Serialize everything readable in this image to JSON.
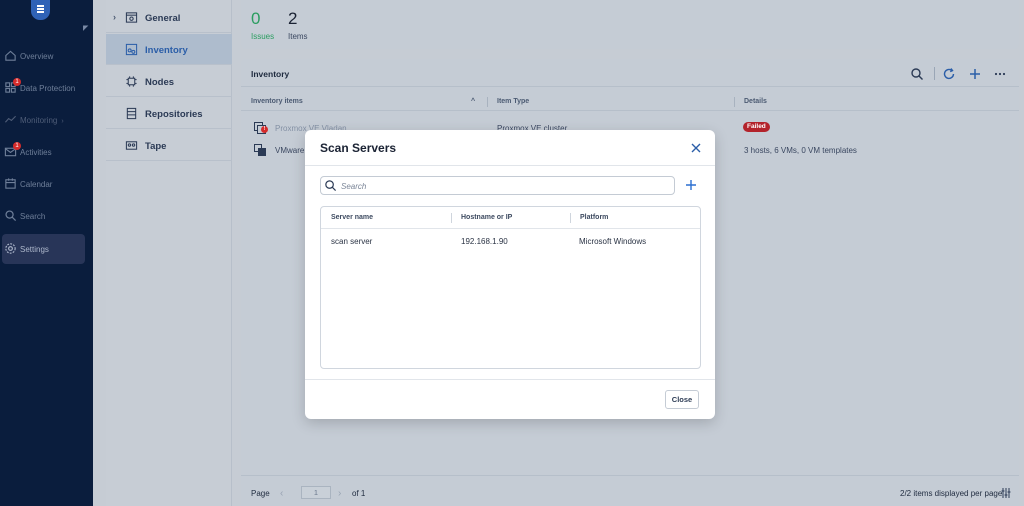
{
  "nav": {
    "items": [
      {
        "label": "Overview",
        "icon": "home-icon"
      },
      {
        "label": "Data Protection",
        "icon": "grid-icon",
        "badge": "1"
      },
      {
        "label": "Monitoring",
        "icon": "chart-icon",
        "suffix": "›"
      },
      {
        "label": "Activities",
        "icon": "mail-icon",
        "badge": "1"
      },
      {
        "label": "Calendar",
        "icon": "calendar-icon"
      },
      {
        "label": "Search",
        "icon": "search-icon"
      },
      {
        "label": "Settings",
        "icon": "gear-icon"
      }
    ]
  },
  "settings_menu": {
    "items": [
      {
        "label": "General"
      },
      {
        "label": "Inventory"
      },
      {
        "label": "Nodes"
      },
      {
        "label": "Repositories"
      },
      {
        "label": "Tape"
      }
    ]
  },
  "stats": {
    "issues_count": "0",
    "issues_label": "Issues",
    "items_count": "2",
    "items_label": "Items"
  },
  "inventory": {
    "title": "Inventory",
    "columns": [
      "Inventory items",
      "Item Type",
      "Details"
    ],
    "rows": [
      {
        "name": "Proxmox VE Vladan",
        "type": "Proxmox VE cluster",
        "details": "Failed"
      },
      {
        "name": "VMware v",
        "type": "",
        "details": "3 hosts, 6 VMs, 0 VM templates"
      }
    ],
    "footer": {
      "page_label": "Page",
      "page_value": "1",
      "of_label": "of 1",
      "per_page": "2/2 items displayed per page"
    }
  },
  "modal": {
    "title": "Scan Servers",
    "search_placeholder": "Search",
    "columns": [
      "Server name",
      "Hostname or IP",
      "Platform"
    ],
    "rows": [
      {
        "name": "scan server",
        "host": "192.168.1.90",
        "platform": "Microsoft Windows"
      }
    ],
    "close_label": "Close"
  },
  "colors": {
    "accent": "#2f6fd1",
    "success": "#2a9d60",
    "danger": "#b3232b",
    "nav_bg": "#0a1d3d"
  }
}
